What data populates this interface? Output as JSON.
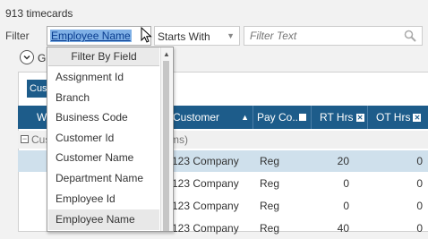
{
  "header": {
    "count_text": "913  timecards"
  },
  "filter": {
    "label": "Filter",
    "field_value": "Employee Name",
    "operator_value": "Starts With",
    "text_placeholder": "Filter Text"
  },
  "grouping": {
    "label": "G"
  },
  "tab": {
    "label": "Cus"
  },
  "grid": {
    "columns": [
      {
        "label": "W"
      },
      {
        "label": "Customer"
      },
      {
        "label": "Pay Co..."
      },
      {
        "label": "RT Hrs"
      },
      {
        "label": "OT Hrs"
      }
    ],
    "group_row": {
      "prefix": "Cus",
      "suffix": "ms)"
    },
    "rows": [
      {
        "customer": "123 Company",
        "pay_code": "Reg",
        "rt": "20",
        "ot": "0"
      },
      {
        "customer": "123 Company",
        "pay_code": "Reg",
        "rt": "0",
        "ot": "0"
      },
      {
        "customer": "123 Company",
        "pay_code": "Reg",
        "rt": "0",
        "ot": "0"
      },
      {
        "customer": "123 Company",
        "pay_code": "Reg",
        "rt": "40",
        "ot": "0"
      }
    ]
  },
  "dropdown": {
    "header": "Filter By Field",
    "items": [
      "Assignment Id",
      "Branch",
      "Business Code",
      "Customer Id",
      "Customer Name",
      "Department Name",
      "Employee Id",
      "Employee Name"
    ]
  },
  "colors": {
    "header_bg": "#1d5c8a",
    "selection": "#7fb0e6",
    "selected_row": "#cfe0ec"
  }
}
